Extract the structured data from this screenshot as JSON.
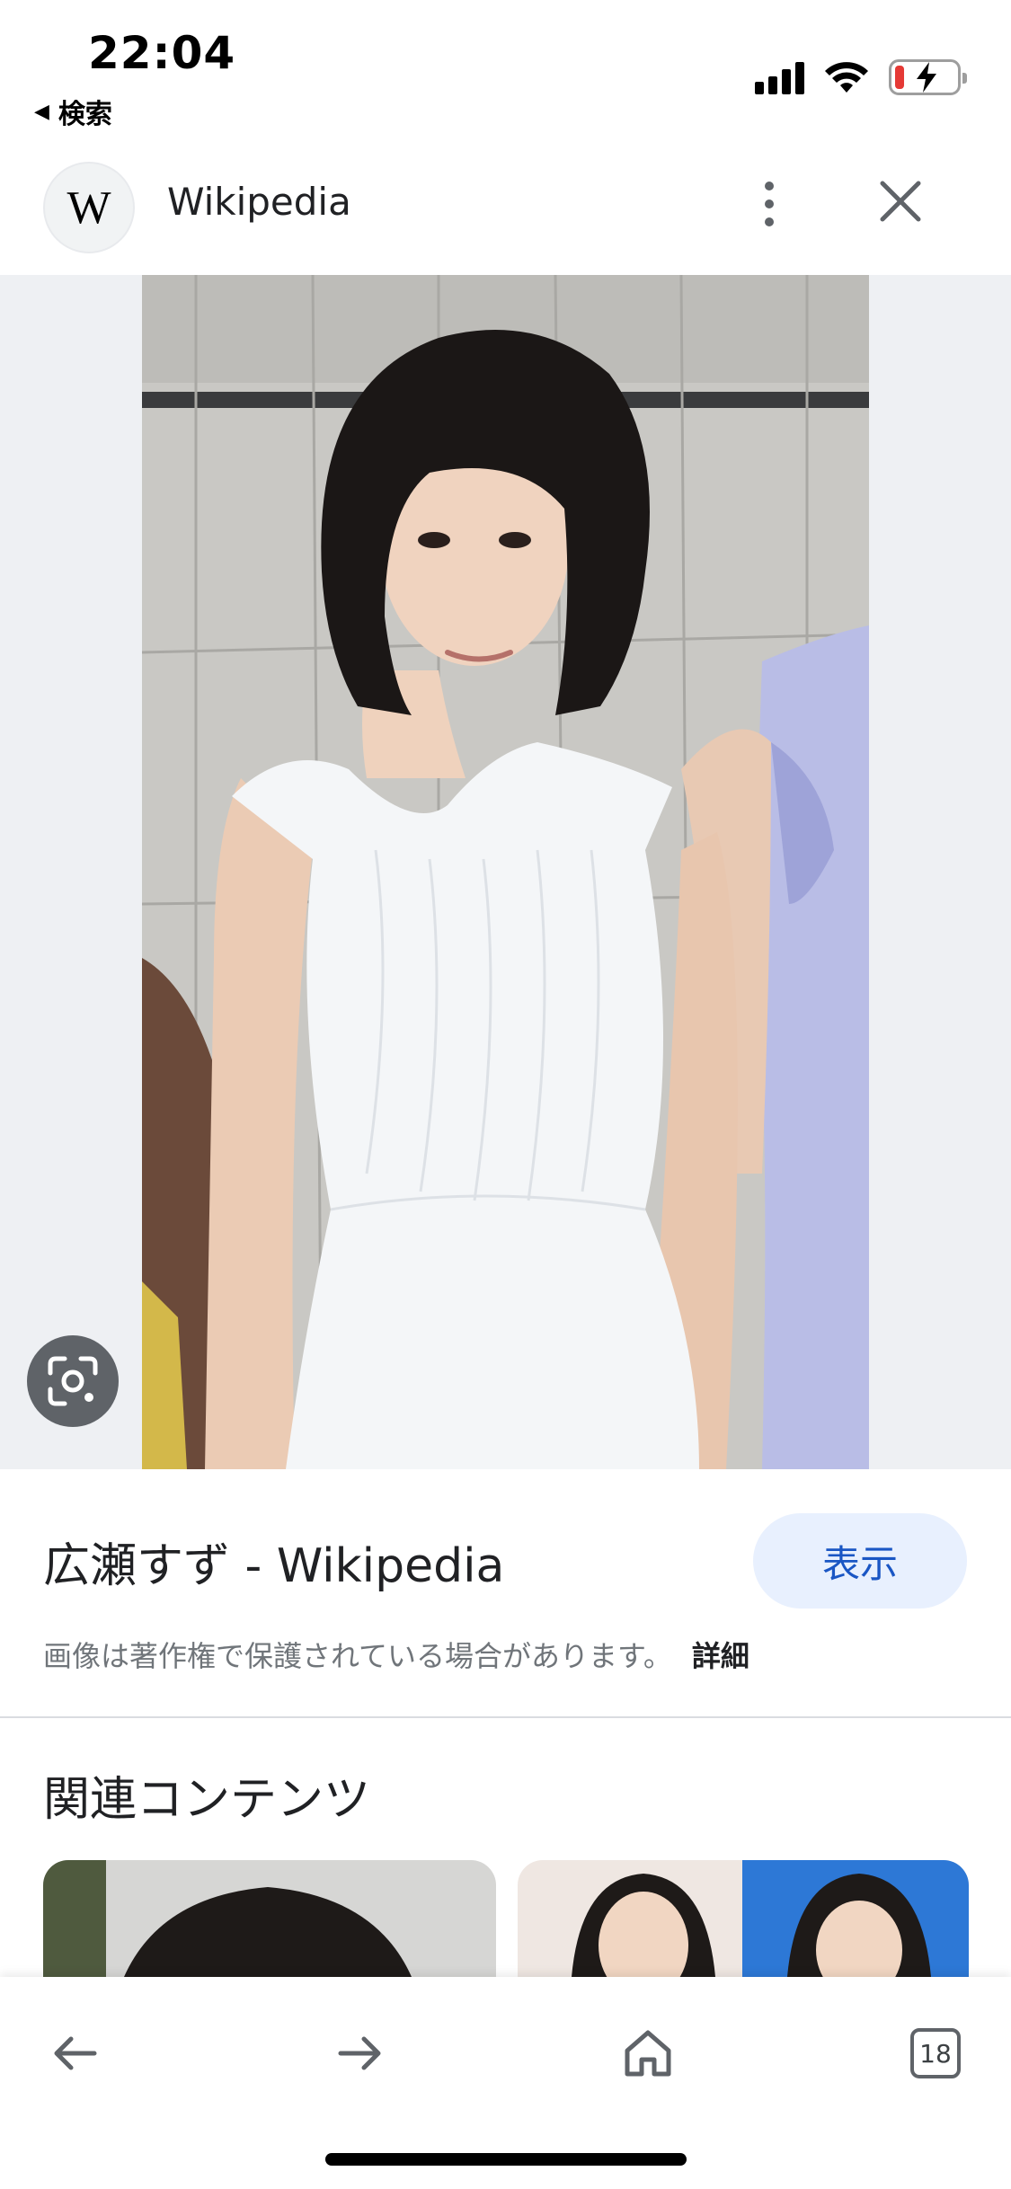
{
  "status_bar": {
    "time": "22:04",
    "back_label": "検索",
    "back_glyph": "◀",
    "battery_color": "#e53935"
  },
  "header": {
    "site_logo_letter": "W",
    "site_name": "Wikipedia",
    "more_icon": "more-vert-icon",
    "close_icon": "close-icon"
  },
  "image_viewer": {
    "lens_icon": "google-lens-icon"
  },
  "result": {
    "title": "広瀬すず - Wikipedia",
    "view_button_label": "表示",
    "copyright_text": "画像は著作権で保護されている場合があります。",
    "details_link": "詳細"
  },
  "related": {
    "section_title": "関連コンテンツ"
  },
  "bottom_nav": {
    "back_icon": "arrow-back-icon",
    "forward_icon": "arrow-forward-icon",
    "home_icon": "home-icon",
    "tabs_count": "18"
  },
  "colors": {
    "accent": "#1a56c4",
    "accent_bg": "#e8f0fe",
    "icon_gray": "#5f6368"
  }
}
